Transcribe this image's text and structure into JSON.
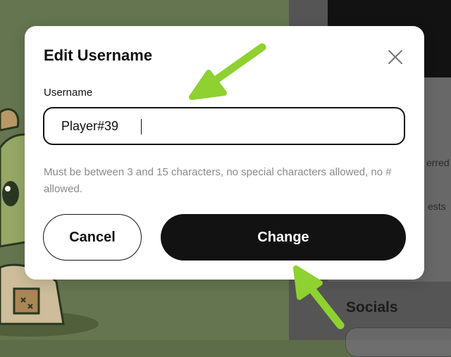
{
  "modal": {
    "title": "Edit Username",
    "close_icon": "close-icon",
    "field_label": "Username",
    "input_value": "Player#39",
    "helper_text": "Must be between 3 and 15 characters, no special characters allowed, no # allowed.",
    "cancel_label": "Cancel",
    "change_label": "Change"
  },
  "background": {
    "side_text_1": "erred",
    "side_text_2": "ests",
    "socials_heading": "Socials"
  },
  "annotations": {
    "arrow_color": "#8ed130",
    "arrow_icons": [
      "arrow-pointing-to-input-icon",
      "arrow-pointing-to-change-button-icon"
    ]
  },
  "colors": {
    "accent_dark": "#121212",
    "helper_gray": "#8a8a8a"
  }
}
